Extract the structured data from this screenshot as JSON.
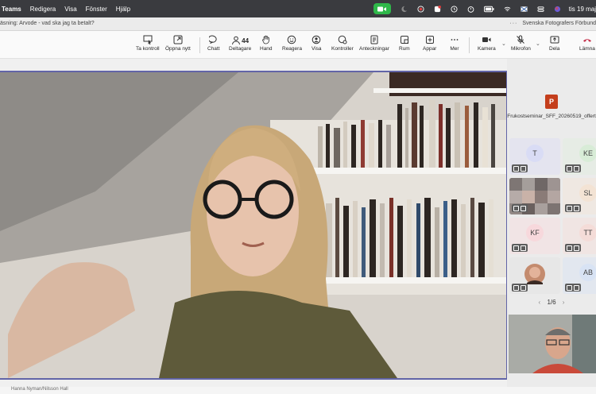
{
  "menubar": {
    "app_name": "Teams",
    "items": [
      "Redigera",
      "Visa",
      "Fönster",
      "Hjälp"
    ],
    "clock": "tis 19 maj"
  },
  "titlebar": {
    "meeting_title": "äsning: Arvode - vad ska jag ta betalt?",
    "org_name": "Svenska Fotografers Förbund",
    "more": "···"
  },
  "toolbar": {
    "take_control": "Ta kontroll",
    "open_new": "Öppna nytt",
    "chat": "Chatt",
    "participants": "Deltagare",
    "participant_count": "44",
    "hand": "Hand",
    "react": "Reagera",
    "view": "Visa",
    "controls": "Kontroller",
    "notes": "Anteckningar",
    "rooms": "Rum",
    "apps": "Appar",
    "more": "Mer",
    "camera": "Kamera",
    "mic": "Mikrofon",
    "share": "Dela",
    "leave": "Lämna"
  },
  "side": {
    "file_name": "Frukostseminar_SFF_20260519_offert",
    "file_badge": "P",
    "tiles": [
      {
        "initials": "T",
        "color": "#d9dcf5",
        "bg": "#e4e4ef"
      },
      {
        "initials": "KE",
        "color": "#d8ecd7",
        "bg": "#e6ece5"
      },
      {
        "initials": "",
        "color": "#b0a8a8",
        "bg": "#8d8582"
      },
      {
        "initials": "SL",
        "color": "#f3e3d4",
        "bg": "#efe8e2"
      },
      {
        "initials": "KF",
        "color": "#f7d8dc",
        "bg": "#f1e4e5"
      },
      {
        "initials": "TT",
        "color": "#f4dcd8",
        "bg": "#f0e5e3"
      },
      {
        "initials": "",
        "color": "#c48b6e",
        "bg": "#e7e7e7"
      },
      {
        "initials": "AB",
        "color": "#d8e3f4",
        "bg": "#e2e7ef"
      }
    ],
    "pager": "1/6",
    "pager_prev": "‹",
    "pager_next": "›"
  },
  "bottom": {
    "name": "Hanna Nyman/Nilsson Hall"
  }
}
